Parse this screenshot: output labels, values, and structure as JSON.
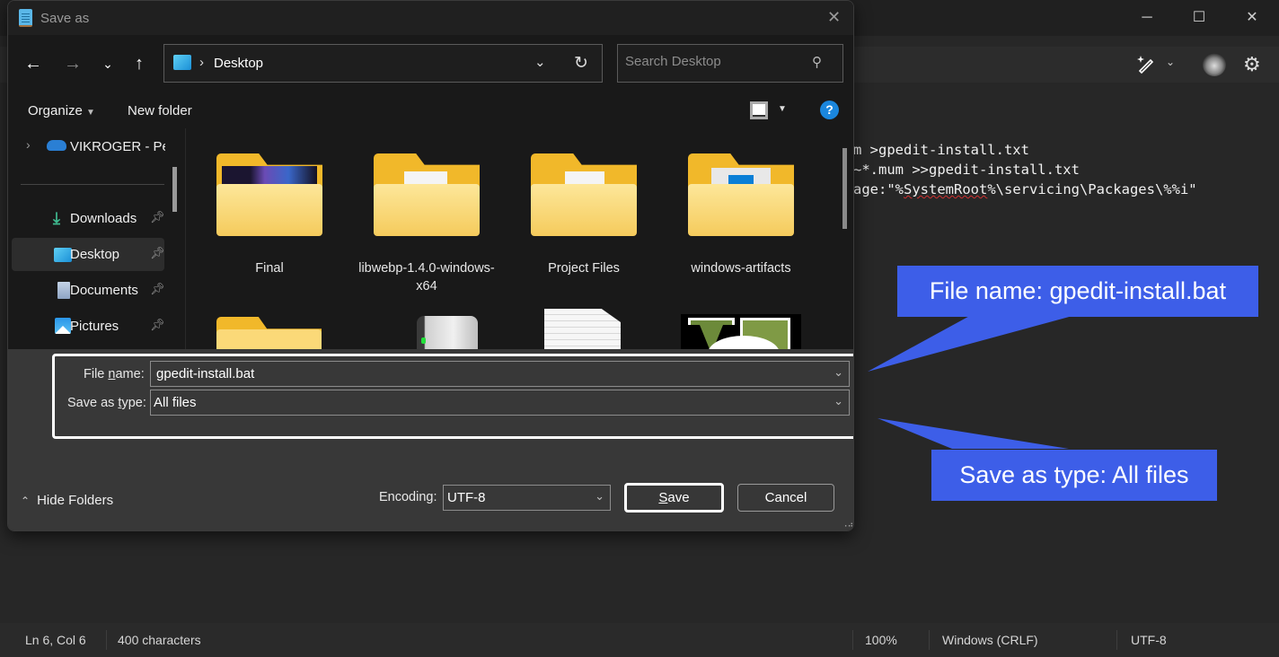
{
  "notepad": {
    "window_controls": {
      "minimize": "─",
      "maximize": "☐",
      "close": "✕"
    },
    "code_lines": [
      {
        "prefix": "m >gpedit-install.txt",
        "squiggle": "",
        "suffix": ""
      },
      {
        "prefix": "~*.mum >>gpedit-install.txt",
        "squiggle": "",
        "suffix": ""
      },
      {
        "prefix": "age:\"%",
        "squiggle": "SystemRoot",
        "suffix": "%\\servicing\\Packages\\%%i\""
      }
    ],
    "status_bar": {
      "position": "Ln 6, Col 6",
      "characters": "400 characters",
      "zoom": "100%",
      "line_ending": "Windows (CRLF)",
      "encoding": "UTF-8"
    }
  },
  "dialog": {
    "title": "Save as",
    "address": {
      "location": "Desktop",
      "separator": "›"
    },
    "search": {
      "placeholder": "Search Desktop"
    },
    "commands": {
      "organize": "Organize",
      "new_folder": "New folder"
    },
    "sidebar": {
      "onedrive": "VIKROGER - Pers",
      "items": [
        {
          "label": "Downloads",
          "selected": false
        },
        {
          "label": "Desktop",
          "selected": true
        },
        {
          "label": "Documents",
          "selected": false
        },
        {
          "label": "Pictures",
          "selected": false
        }
      ]
    },
    "files": [
      {
        "name": "Final",
        "type": "folder"
      },
      {
        "name": "libwebp-1.4.0-windows-x64",
        "type": "folder"
      },
      {
        "name": "Project Files",
        "type": "folder"
      },
      {
        "name": "windows-artifacts",
        "type": "folder"
      }
    ],
    "form": {
      "file_name_label_pre": "File ",
      "file_name_label_ul": "n",
      "file_name_label_post": "ame:",
      "file_name_value": "gpedit-install.bat",
      "type_label_pre": "Save as ",
      "type_label_ul": "t",
      "type_label_post": "ype:",
      "type_value": "All files",
      "encoding_label": "Encoding:",
      "encoding_value": "UTF-8"
    },
    "hide_folders": "Hide Folders",
    "save_ul": "S",
    "save_rest": "ave",
    "cancel": "Cancel"
  },
  "callouts": {
    "file_name": "File name: gpedit-install.bat",
    "save_type": "Save as type: All files",
    "color": "#3d5ee8"
  }
}
